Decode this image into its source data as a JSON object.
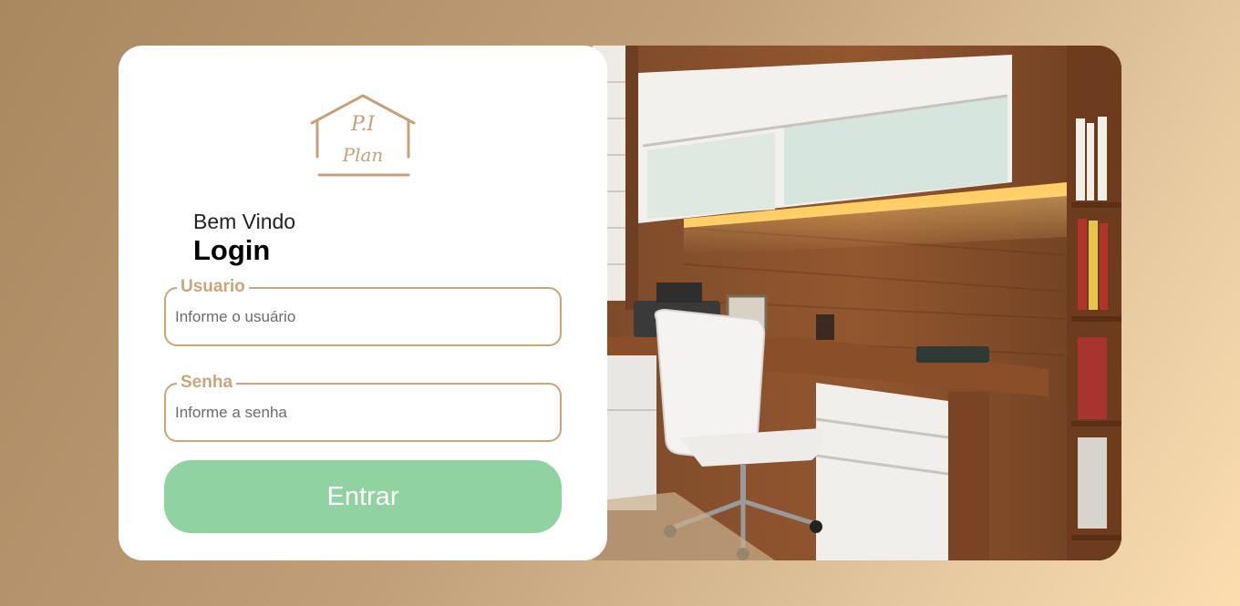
{
  "logo": {
    "line1": "P.I",
    "line2": "Plan"
  },
  "login": {
    "welcome": "Bem Vindo",
    "title": "Login",
    "username": {
      "label": "Usuario",
      "placeholder": "Informe o usuário",
      "value": ""
    },
    "password": {
      "label": "Senha",
      "placeholder": "Informe a senha",
      "value": ""
    },
    "submit_label": "Entrar"
  },
  "colors": {
    "accent": "#c9a57d",
    "button": "#90d2a0",
    "background_start": "#a9875f",
    "background_end": "#fbddb0"
  },
  "icons": [
    "house-logo-icon"
  ]
}
